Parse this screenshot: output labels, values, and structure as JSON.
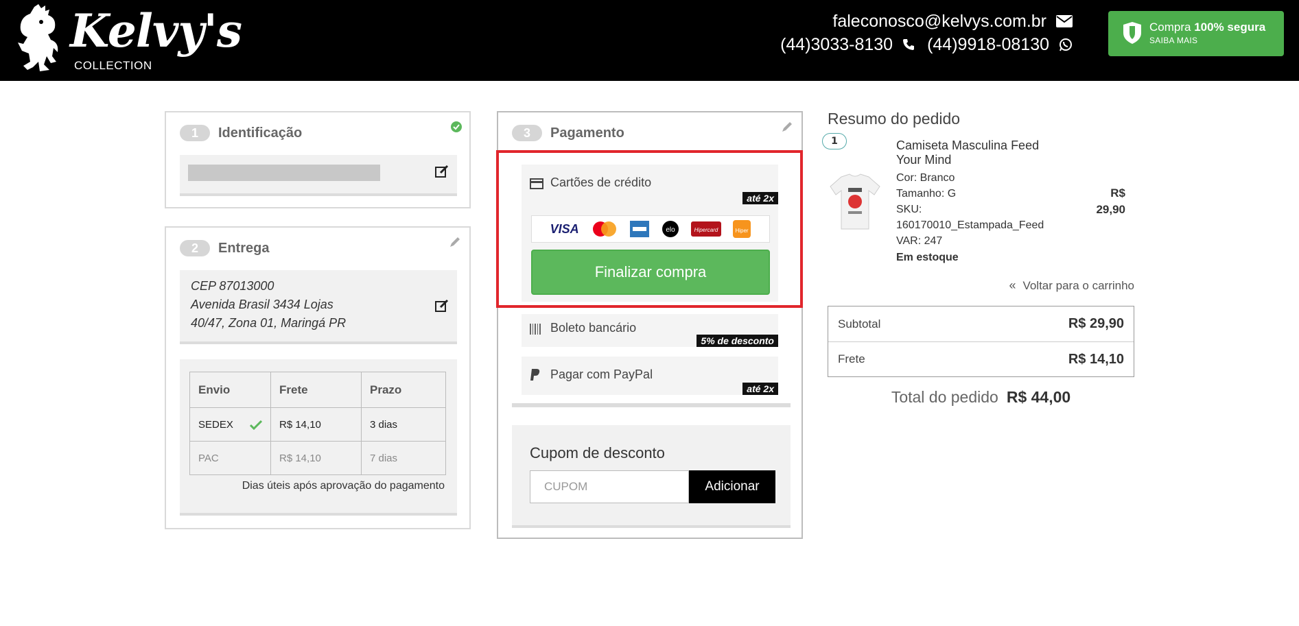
{
  "header": {
    "logo_script": "Kelvy's",
    "logo_sub": "COLLECTION",
    "email": "faleconosco@kelvys.com.br",
    "phone": "(44)3033-8130",
    "whatsapp": "(44)9918-08130",
    "secure_prefix": "Compra",
    "secure_bold": "100% segura",
    "secure_link": "SAIBA MAIS",
    "icons": [
      "envelope-icon",
      "phone-icon",
      "whatsapp-icon",
      "shield-icon"
    ]
  },
  "step1": {
    "number": "1",
    "title": "Identificação"
  },
  "step2": {
    "number": "2",
    "title": "Entrega",
    "address": [
      "CEP 87013000",
      "Avenida Brasil 3434 Lojas",
      "40/47, Zona 01, Maringá PR"
    ],
    "shipping": {
      "headers": [
        "Envio",
        "Frete",
        "Prazo"
      ],
      "rows": [
        {
          "method": "SEDEX",
          "price": "R$ 14,10",
          "time": "3 dias",
          "selected": true
        },
        {
          "method": "PAC",
          "price": "R$ 14,10",
          "time": "7 dias",
          "selected": false
        }
      ],
      "note": "Dias úteis após aprovação do pagamento"
    }
  },
  "step3": {
    "number": "3",
    "title": "Pagamento",
    "credit": {
      "label": "Cartões de crédito",
      "badge": "até 2x"
    },
    "card_brands": [
      "VISA",
      "MasterCard",
      "AMEX",
      "elo",
      "Hipercard",
      "Hiper"
    ],
    "finish_button": "Finalizar compra",
    "boleto": {
      "label": "Boleto bancário",
      "badge": "5% de desconto"
    },
    "paypal": {
      "label": "Pagar com PayPal",
      "badge": "até 2x"
    },
    "coupon": {
      "title": "Cupom de desconto",
      "placeholder": "CUPOM",
      "button": "Adicionar"
    }
  },
  "summary": {
    "title": "Resumo do pedido",
    "item": {
      "qty": "1",
      "name": "Camiseta Masculina Feed Your Mind",
      "color": "Cor: Branco",
      "size": "Tamanho: G",
      "sku_label": "SKU:",
      "sku_value": "160170010_Estampada_Feed",
      "var": "VAR: 247",
      "stock": "Em estoque",
      "price_currency": "R$",
      "price_value": "29,90"
    },
    "back_link": "Voltar para o carrinho",
    "subtotal_label": "Subtotal",
    "subtotal_value": "R$ 29,90",
    "freight_label": "Frete",
    "freight_value": "R$ 14,10",
    "total_label": "Total do pedido",
    "total_value": "R$ 44,00"
  },
  "colors": {
    "green": "#5cb85c",
    "highlight_red": "#e1262c",
    "header_bg": "#000000"
  }
}
